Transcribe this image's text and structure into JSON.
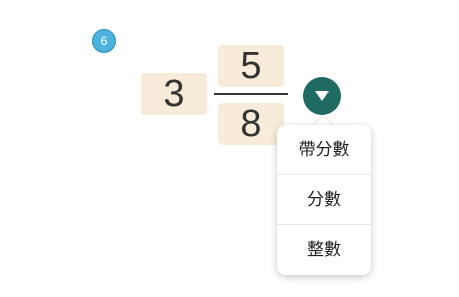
{
  "question": {
    "number": "6"
  },
  "mixed_number": {
    "whole": "3",
    "numerator": "5",
    "denominator": "8"
  },
  "dropdown": {
    "icon": "caret-down-icon",
    "options": [
      {
        "label": "帶分數"
      },
      {
        "label": "分數"
      },
      {
        "label": "整數"
      }
    ]
  },
  "colors": {
    "badge": "#4bb3dd",
    "answer_box": "#f7ecd9",
    "dropdown_button": "#1f6b62"
  }
}
